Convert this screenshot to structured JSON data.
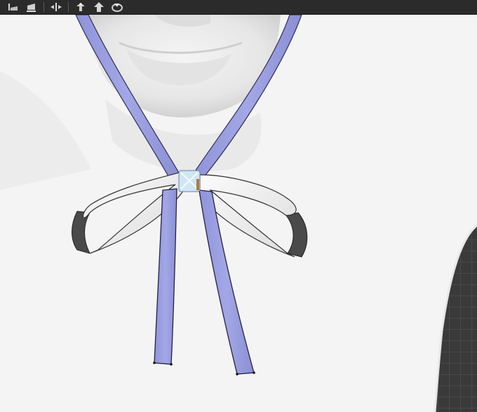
{
  "toolbar": {
    "tools": [
      {
        "id": "tool-1",
        "icon": "align-left-icon"
      },
      {
        "id": "tool-2",
        "icon": "align-bottom-icon"
      },
      {
        "id": "tool-3",
        "icon": "snap-center-icon"
      },
      {
        "id": "tool-4",
        "icon": "move-pin-icon"
      },
      {
        "id": "tool-5",
        "icon": "push-up-icon"
      },
      {
        "id": "tool-6",
        "icon": "rotate-fit-icon"
      }
    ]
  },
  "viewport": {
    "background": "#ffffff",
    "ribbon_color": "#9a9ee0",
    "bow_color": "#f2f2f2",
    "grid_color": "#4a4a4a"
  }
}
